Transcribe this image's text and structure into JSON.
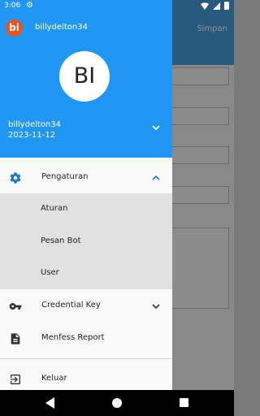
{
  "status_bar": {
    "time": "3:06",
    "icons": [
      "settings-icon",
      "wifi-icon",
      "signal-icon",
      "battery-icon"
    ]
  },
  "background_app": {
    "save_label": "Simpan"
  },
  "drawer": {
    "header": {
      "app_logo_text": "bi",
      "username": "billydelton34",
      "avatar_initials": "BI",
      "account_name": "billydelton34",
      "account_date": "2023-11-12",
      "background_color": "#2196f3"
    },
    "menu": {
      "settings": {
        "label": "Pengaturan",
        "icon": "gear-icon",
        "expanded": true,
        "accent_color": "#1976d2"
      },
      "settings_children": [
        {
          "label": "Aturan"
        },
        {
          "label": "Pesan Bot"
        },
        {
          "label": "User"
        }
      ],
      "credential_key": {
        "label": "Credential Key",
        "icon": "key-icon",
        "expanded": false
      },
      "menfess_report": {
        "label": "Menfess Report",
        "icon": "document-icon"
      },
      "logout": {
        "label": "Keluar",
        "icon": "logout-icon"
      }
    }
  },
  "nav_bar": {
    "buttons": [
      "back-icon",
      "home-icon",
      "recents-icon"
    ]
  }
}
